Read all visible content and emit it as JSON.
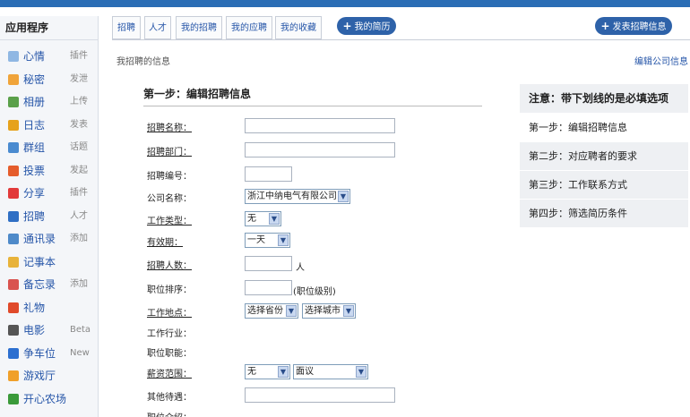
{
  "sidebar": {
    "title": "应用程序",
    "items": [
      {
        "label": "心情",
        "action": "插件",
        "icon": "mood-icon",
        "color": "#8fb7e3"
      },
      {
        "label": "秘密",
        "action": "发泄",
        "icon": "secret-icon",
        "color": "#f0a43a"
      },
      {
        "label": "相册",
        "action": "上传",
        "icon": "album-icon",
        "color": "#5aa04a"
      },
      {
        "label": "日志",
        "action": "发表",
        "icon": "blog-icon",
        "color": "#e6a21c"
      },
      {
        "label": "群组",
        "action": "话题",
        "icon": "group-icon",
        "color": "#4a8bd0"
      },
      {
        "label": "投票",
        "action": "发起",
        "icon": "vote-icon",
        "color": "#e55d2c"
      },
      {
        "label": "分享",
        "action": "插件",
        "icon": "share-icon",
        "color": "#e23a3a"
      },
      {
        "label": "招聘",
        "action": "人才",
        "icon": "recruit-icon",
        "color": "#2f6fc4"
      },
      {
        "label": "通讯录",
        "action": "添加",
        "icon": "contacts-icon",
        "color": "#4e8ac9"
      },
      {
        "label": "记事本",
        "action": "",
        "icon": "notepad-icon",
        "color": "#e8b33a"
      },
      {
        "label": "备忘录",
        "action": "添加",
        "icon": "memo-icon",
        "color": "#d9534f"
      },
      {
        "label": "礼物",
        "action": "",
        "icon": "gift-icon",
        "color": "#e04a2a"
      },
      {
        "label": "电影",
        "action": "Beta",
        "icon": "movie-icon",
        "color": "#555555"
      },
      {
        "label": "争车位",
        "action": "New",
        "icon": "parking-icon",
        "color": "#2c6fd0"
      },
      {
        "label": "游戏厅",
        "action": "",
        "icon": "game-icon",
        "color": "#f0a02a"
      },
      {
        "label": "开心农场",
        "action": "",
        "icon": "farm-icon",
        "color": "#3a9a3a"
      }
    ]
  },
  "tabs": [
    "招聘",
    "人才",
    "我的招聘",
    "我的应聘",
    "我的收藏"
  ],
  "my_resume_button": "我的简历",
  "post_job_button": "发表招聘信息",
  "breadcrumb": "我招聘的信息",
  "edit_company_link": "编辑公司信息",
  "form": {
    "title": "第一步：编辑招聘信息",
    "fields": {
      "job_name": "招聘名称：",
      "department": "招聘部门：",
      "job_number": "招聘编号：",
      "company_name": "公司名称：",
      "work_type": "工作类型：",
      "validity": "有效期：",
      "headcount": "招聘人数：",
      "position_rank": "职位排序：",
      "location": "工作地点：",
      "industry": "工作行业：",
      "function": "职位职能：",
      "salary": "薪资范围：",
      "benefits": "其他待遇：",
      "description": "职位介绍："
    },
    "values": {
      "company_name": "浙江中纳电气有限公司",
      "work_type": "无",
      "validity": "一天",
      "headcount_suffix": "人",
      "rank_suffix": "(职位级别)",
      "province": "选择省份",
      "city": "选择城市",
      "salary_from": "无",
      "salary_to": "面议"
    }
  },
  "steps_panel": {
    "note": "注意：带下划线的是必填选项",
    "steps": [
      "第一步：编辑招聘信息",
      "第二步：对应聘者的要求",
      "第三步：工作联系方式",
      "第四步：筛选简历条件"
    ]
  },
  "colors": {
    "accent": "#2e62a9",
    "link": "#2555a8"
  }
}
